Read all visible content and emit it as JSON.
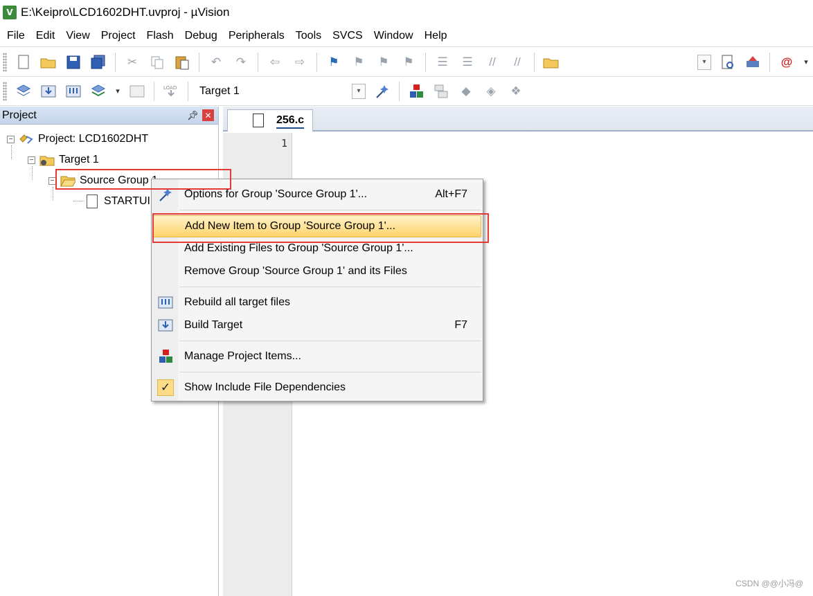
{
  "window": {
    "title": "E:\\Keipro\\LCD1602DHT.uvproj - µVision",
    "app_icon": "uvision-logo-icon"
  },
  "menubar": {
    "items": [
      "File",
      "Edit",
      "View",
      "Project",
      "Flash",
      "Debug",
      "Peripherals",
      "Tools",
      "SVCS",
      "Window",
      "Help"
    ]
  },
  "toolbar2": {
    "target": "Target 1"
  },
  "project_panel": {
    "title": "Project",
    "tree": {
      "project": "Project: LCD1602DHT",
      "target": "Target 1",
      "group": "Source Group 1",
      "file": "STARTUI"
    }
  },
  "editor": {
    "tab": "256.c",
    "line_number": "1"
  },
  "context_menu": {
    "items": [
      {
        "label": "Options for Group 'Source Group 1'...",
        "shortcut": "Alt+F7",
        "icon": "options-wand-icon"
      },
      {
        "label": "Add New  Item to Group 'Source Group 1'...",
        "shortcut": "",
        "icon": "",
        "highlighted": true
      },
      {
        "label": "Add Existing Files to Group 'Source Group 1'...",
        "shortcut": "",
        "icon": ""
      },
      {
        "label": "Remove Group 'Source Group 1' and its Files",
        "shortcut": "",
        "icon": ""
      },
      {
        "label": "Rebuild all target files",
        "shortcut": "",
        "icon": "rebuild-icon"
      },
      {
        "label": "Build Target",
        "shortcut": "F7",
        "icon": "build-icon"
      },
      {
        "label": "Manage Project Items...",
        "shortcut": "",
        "icon": "manage-items-icon"
      },
      {
        "label": "Show Include File Dependencies",
        "shortcut": "",
        "icon": "checkmark-icon",
        "checked": true
      }
    ]
  },
  "colors": {
    "highlight": "#ffd36b",
    "annotation": "#e53935",
    "panel_header": "#c4d4ea"
  },
  "watermark": "CSDN @@小冯@"
}
